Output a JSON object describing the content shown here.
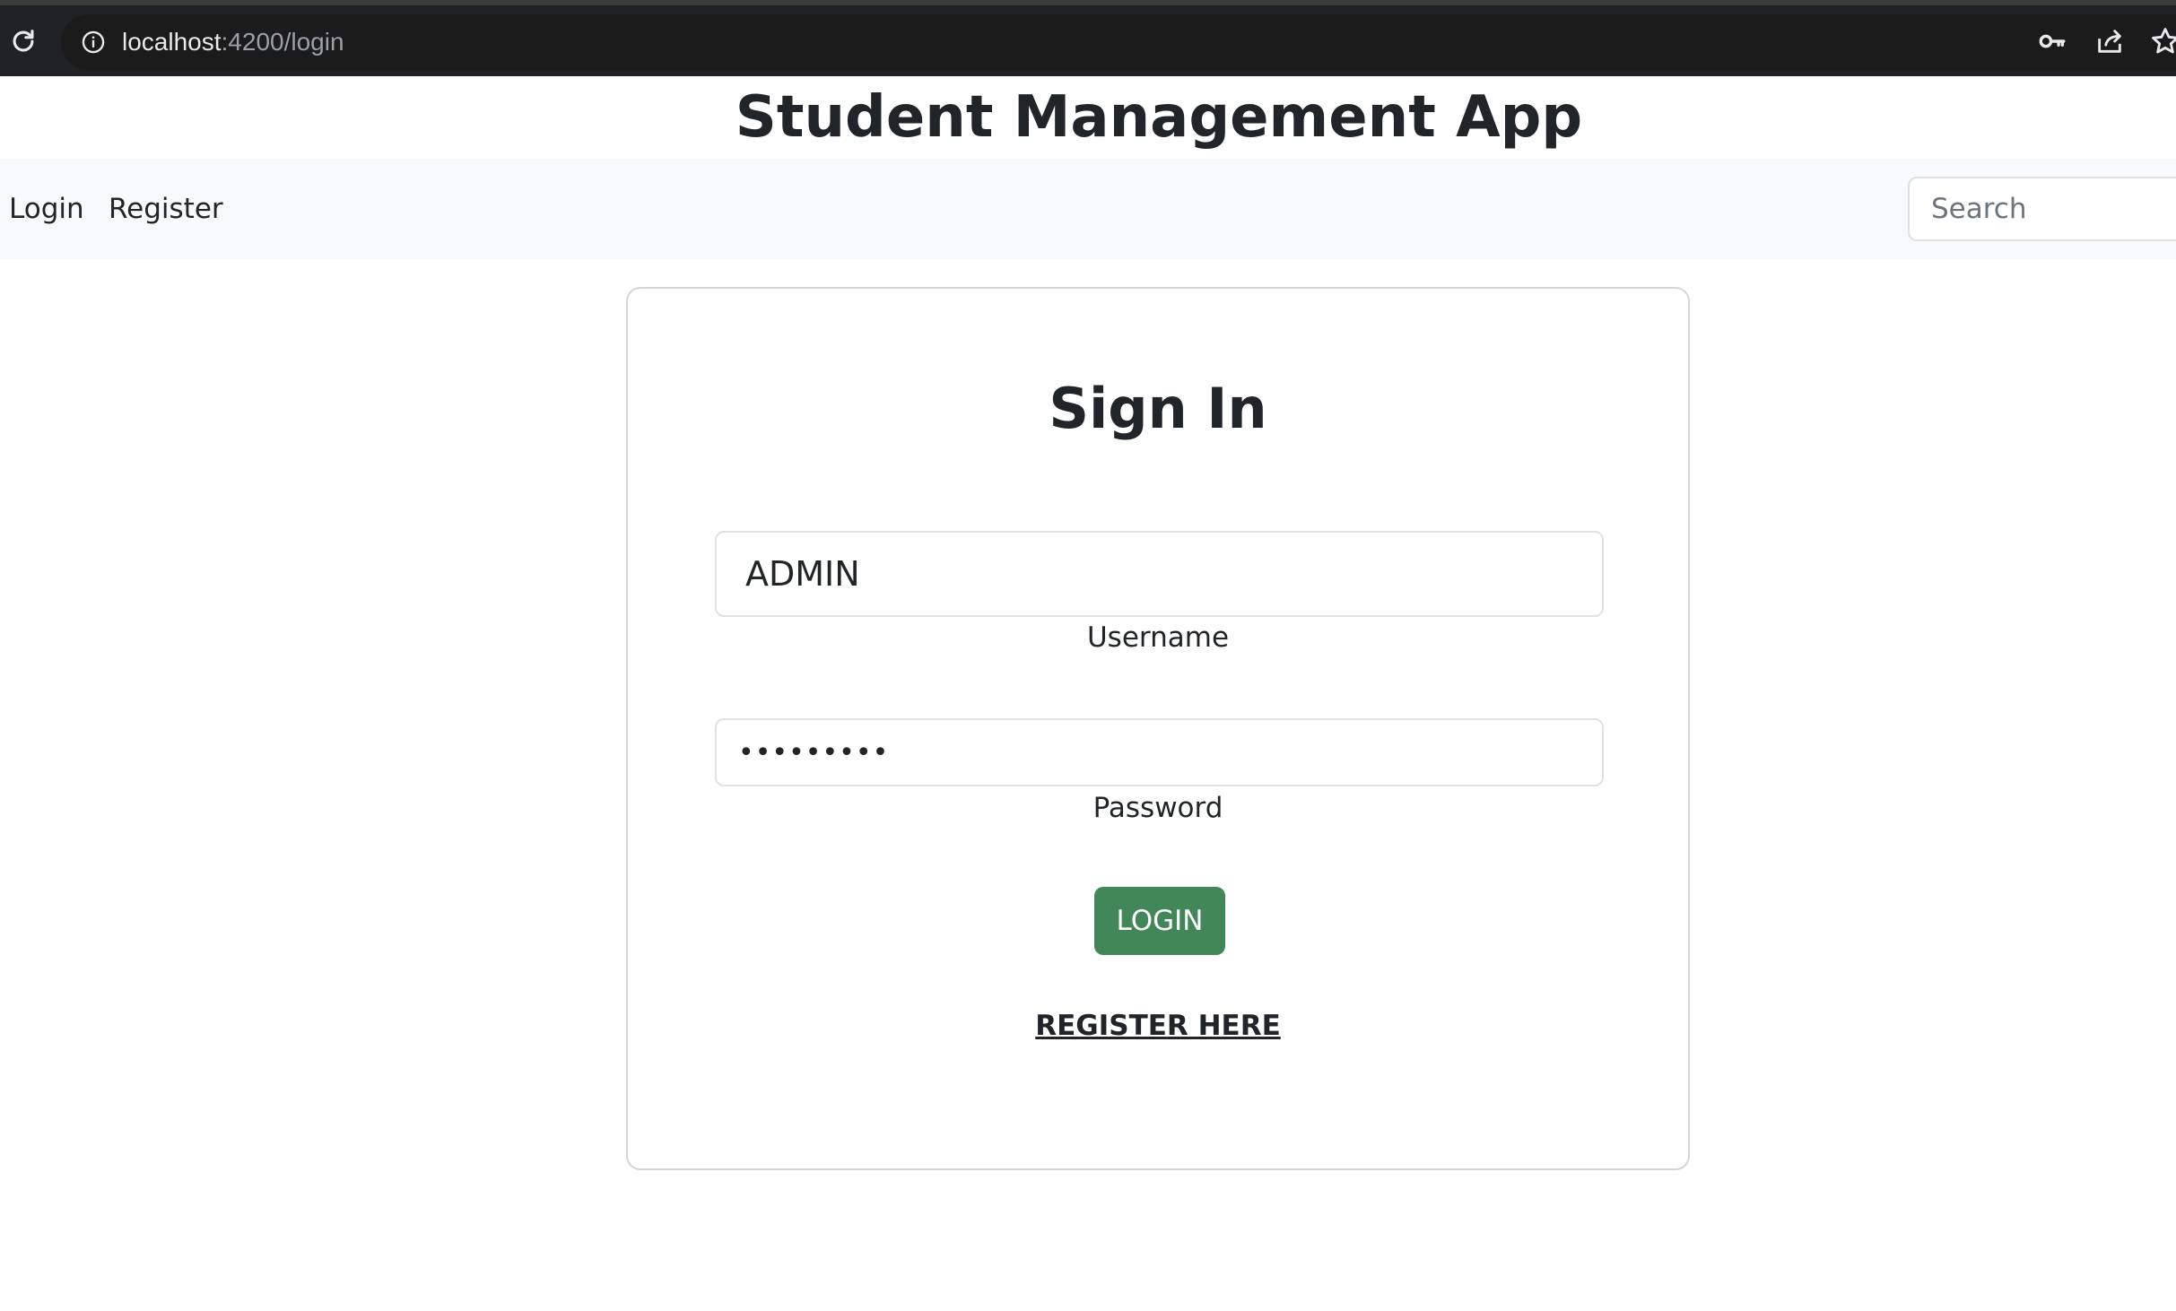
{
  "browser": {
    "url_host": "localhost",
    "url_path": ":4200/login",
    "icons": [
      "reload-icon",
      "info-icon",
      "key-icon",
      "share-icon",
      "star-icon"
    ]
  },
  "app": {
    "title": "Student Management App"
  },
  "nav": {
    "items": [
      {
        "label": "Login"
      },
      {
        "label": "Register"
      }
    ],
    "search_placeholder": "Search"
  },
  "signin": {
    "title": "Sign In",
    "username_value": "ADMIN",
    "username_label": "Username",
    "password_value": "•••••••••",
    "password_label": "Password",
    "login_label": "LOGIN",
    "register_label": "REGISTER HERE"
  },
  "colors": {
    "login_button": "#428757",
    "navbar_background": "#f8f9fa",
    "browser_bar": "#202124"
  }
}
